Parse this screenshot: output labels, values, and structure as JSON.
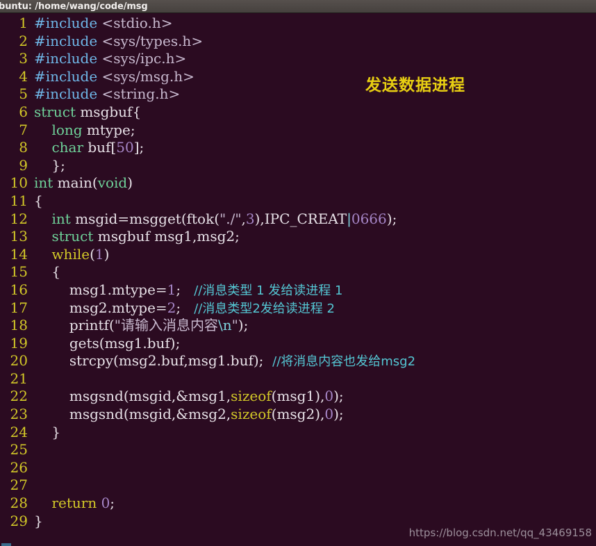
{
  "window": {
    "title": "buntu: /home/wang/code/msg"
  },
  "annotation": {
    "text": "发送数据进程",
    "color": "#e8cf12"
  },
  "watermark": {
    "text": "https://blog.csdn.net/qq_43469158"
  },
  "theme": {
    "background": "#2b0b21",
    "titlebar_background": "#4a4542",
    "linenumber_color": "#d3c928",
    "comment_color": "#54c7d4",
    "keyword_color": "#6fd39a",
    "preprocessor_color": "#6fb7e8",
    "string_color": "#c8b9cf",
    "number_color": "#a585c6"
  },
  "editor": {
    "lines": [
      {
        "n": "1",
        "text": "#include <stdio.h>"
      },
      {
        "n": "2",
        "text": "#include <sys/types.h>"
      },
      {
        "n": "3",
        "text": "#include <sys/ipc.h>"
      },
      {
        "n": "4",
        "text": "#include <sys/msg.h>"
      },
      {
        "n": "5",
        "text": "#include <string.h>"
      },
      {
        "n": "6",
        "text": "struct msgbuf{"
      },
      {
        "n": "7",
        "text": "    long mtype;"
      },
      {
        "n": "8",
        "text": "    char buf[50];"
      },
      {
        "n": "9",
        "text": "    };"
      },
      {
        "n": "10",
        "text": "int main(void)"
      },
      {
        "n": "11",
        "text": "{"
      },
      {
        "n": "12",
        "text": "    int msgid=msgget(ftok(\"./\",3),IPC_CREAT|0666);"
      },
      {
        "n": "13",
        "text": "    struct msgbuf msg1,msg2;"
      },
      {
        "n": "14",
        "text": "    while(1)"
      },
      {
        "n": "15",
        "text": "    {"
      },
      {
        "n": "16",
        "text": "        msg1.mtype=1;   //消息类型 1 发给读进程 1"
      },
      {
        "n": "17",
        "text": "        msg2.mtype=2;   //消息类型2发给读进程 2"
      },
      {
        "n": "18",
        "text": "        printf(\"请输入消息内容\\n\");"
      },
      {
        "n": "19",
        "text": "        gets(msg1.buf);"
      },
      {
        "n": "20",
        "text": "        strcpy(msg2.buf,msg1.buf);  //将消息内容也发给msg2"
      },
      {
        "n": "21",
        "text": ""
      },
      {
        "n": "22",
        "text": "        msgsnd(msgid,&msg1,sizeof(msg1),0);"
      },
      {
        "n": "23",
        "text": "        msgsnd(msgid,&msg2,sizeof(msg2),0);"
      },
      {
        "n": "24",
        "text": "    }"
      },
      {
        "n": "25",
        "text": ""
      },
      {
        "n": "26",
        "text": ""
      },
      {
        "n": "27",
        "text": ""
      },
      {
        "n": "28",
        "text": "    return 0;"
      },
      {
        "n": "29",
        "text": "}"
      }
    ],
    "tokens": [
      [
        {
          "c": "t-pre",
          "t": "#include"
        },
        {
          "c": "t-id",
          "t": " "
        },
        {
          "c": "t-hdr",
          "t": "<stdio.h>"
        }
      ],
      [
        {
          "c": "t-pre",
          "t": "#include"
        },
        {
          "c": "t-id",
          "t": " "
        },
        {
          "c": "t-hdr",
          "t": "<sys/types.h>"
        }
      ],
      [
        {
          "c": "t-pre",
          "t": "#include"
        },
        {
          "c": "t-id",
          "t": " "
        },
        {
          "c": "t-hdr",
          "t": "<sys/ipc.h>"
        }
      ],
      [
        {
          "c": "t-pre",
          "t": "#include"
        },
        {
          "c": "t-id",
          "t": " "
        },
        {
          "c": "t-hdr",
          "t": "<sys/msg.h>"
        }
      ],
      [
        {
          "c": "t-pre",
          "t": "#include"
        },
        {
          "c": "t-id",
          "t": " "
        },
        {
          "c": "t-hdr",
          "t": "<string.h>"
        }
      ],
      [
        {
          "c": "t-kw",
          "t": "struct"
        },
        {
          "c": "t-id",
          "t": " msgbuf{"
        }
      ],
      [
        {
          "c": "t-id",
          "t": "    "
        },
        {
          "c": "t-kw",
          "t": "long"
        },
        {
          "c": "t-id",
          "t": " mtype;"
        }
      ],
      [
        {
          "c": "t-id",
          "t": "    "
        },
        {
          "c": "t-kw",
          "t": "char"
        },
        {
          "c": "t-id",
          "t": " buf["
        },
        {
          "c": "t-num",
          "t": "50"
        },
        {
          "c": "t-id",
          "t": "];"
        }
      ],
      [
        {
          "c": "t-id",
          "t": "    };"
        }
      ],
      [
        {
          "c": "t-kw",
          "t": "int"
        },
        {
          "c": "t-id",
          "t": " main("
        },
        {
          "c": "t-kw",
          "t": "void"
        },
        {
          "c": "t-id",
          "t": ")"
        }
      ],
      [
        {
          "c": "t-id",
          "t": "{"
        }
      ],
      [
        {
          "c": "t-id",
          "t": "    "
        },
        {
          "c": "t-kw",
          "t": "int"
        },
        {
          "c": "t-id",
          "t": " msgid=msgget(ftok("
        },
        {
          "c": "t-str",
          "t": "\"./\""
        },
        {
          "c": "t-id",
          "t": ","
        },
        {
          "c": "t-num",
          "t": "3"
        },
        {
          "c": "t-id",
          "t": "),IPC_CREAT"
        },
        {
          "c": "t-op",
          "t": "|"
        },
        {
          "c": "t-num",
          "t": "0666"
        },
        {
          "c": "t-id",
          "t": ");"
        }
      ],
      [
        {
          "c": "t-id",
          "t": "    "
        },
        {
          "c": "t-kw",
          "t": "struct"
        },
        {
          "c": "t-id",
          "t": " msgbuf msg1,msg2;"
        }
      ],
      [
        {
          "c": "t-id",
          "t": "    "
        },
        {
          "c": "t-kw2",
          "t": "while"
        },
        {
          "c": "t-id",
          "t": "("
        },
        {
          "c": "t-num",
          "t": "1"
        },
        {
          "c": "t-id",
          "t": ")"
        }
      ],
      [
        {
          "c": "t-id",
          "t": "    {"
        }
      ],
      [
        {
          "c": "t-id",
          "t": "        msg1.mtype="
        },
        {
          "c": "t-num",
          "t": "1"
        },
        {
          "c": "t-id",
          "t": ";   "
        },
        {
          "c": "t-cmt",
          "t": "//消息类型 1 发给读进程 1"
        }
      ],
      [
        {
          "c": "t-id",
          "t": "        msg2.mtype="
        },
        {
          "c": "t-num",
          "t": "2"
        },
        {
          "c": "t-id",
          "t": ";   "
        },
        {
          "c": "t-cmt",
          "t": "//消息类型2发给读进程 2"
        }
      ],
      [
        {
          "c": "t-id",
          "t": "        printf("
        },
        {
          "c": "t-str",
          "t": "\"请输入消息内容"
        },
        {
          "c": "t-esc",
          "t": "\\n"
        },
        {
          "c": "t-str",
          "t": "\""
        },
        {
          "c": "t-id",
          "t": ");"
        }
      ],
      [
        {
          "c": "t-id",
          "t": "        gets(msg1.buf);"
        }
      ],
      [
        {
          "c": "t-id",
          "t": "        strcpy(msg2.buf,msg1.buf);  "
        },
        {
          "c": "t-cmt",
          "t": "//将消息内容也发给msg2"
        }
      ],
      [],
      [
        {
          "c": "t-id",
          "t": "        msgsnd(msgid,&msg1,"
        },
        {
          "c": "t-kw2",
          "t": "sizeof"
        },
        {
          "c": "t-id",
          "t": "(msg1),"
        },
        {
          "c": "t-num",
          "t": "0"
        },
        {
          "c": "t-id",
          "t": ");"
        }
      ],
      [
        {
          "c": "t-id",
          "t": "        msgsnd(msgid,&msg2,"
        },
        {
          "c": "t-kw2",
          "t": "sizeof"
        },
        {
          "c": "t-id",
          "t": "(msg2),"
        },
        {
          "c": "t-num",
          "t": "0"
        },
        {
          "c": "t-id",
          "t": ");"
        }
      ],
      [
        {
          "c": "t-id",
          "t": "    }"
        }
      ],
      [],
      [],
      [],
      [
        {
          "c": "t-id",
          "t": "    "
        },
        {
          "c": "t-kw3",
          "t": "return"
        },
        {
          "c": "t-id",
          "t": " "
        },
        {
          "c": "t-num",
          "t": "0"
        },
        {
          "c": "t-id",
          "t": ";"
        }
      ],
      [
        {
          "c": "t-id",
          "t": "}"
        }
      ]
    ]
  }
}
